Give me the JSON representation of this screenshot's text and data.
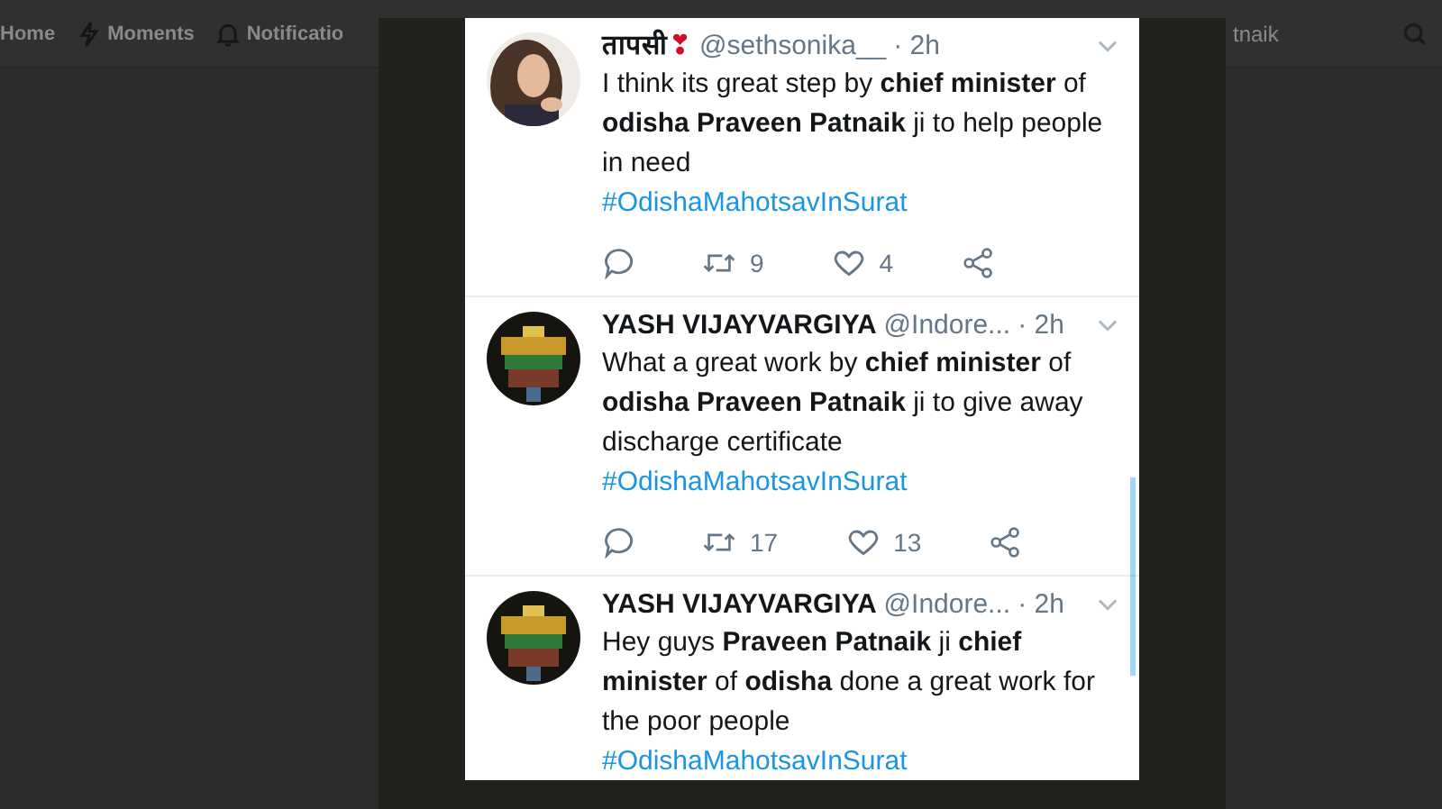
{
  "nav": {
    "items": [
      {
        "label": "Home"
      },
      {
        "label": "Moments"
      },
      {
        "label": "Notificatio"
      }
    ],
    "search": {
      "value": "tnaik"
    }
  },
  "tweets": [
    {
      "name": "तापसी",
      "emoji": "❣",
      "handle": "@sethsonika__",
      "time": "· 2h",
      "text": "I think its  great step by **chief minister** of **odisha Praveen Patnaik** ji to help people in need",
      "hashtag": "#OdishaMahotsavInSurat",
      "actions": {
        "retweets": "9",
        "likes": "4"
      }
    },
    {
      "name": "YASH VIJAYVARGIYA",
      "handle": "@Indore...",
      "time": "· 2h",
      "text": "What a great work by **chief minister** of **odisha Praveen Patnaik** ji to give away discharge certificate",
      "hashtag": "#OdishaMahotsavInSurat",
      "actions": {
        "retweets": "17",
        "likes": "13"
      }
    },
    {
      "name": "YASH VIJAYVARGIYA",
      "handle": "@Indore...",
      "time": "· 2h",
      "text": "Hey guys **Praveen Patnaik** ji **chief minister** of **odisha** done a great work for the poor people",
      "hashtag": "#OdishaMahotsavInSurat"
    }
  ]
}
